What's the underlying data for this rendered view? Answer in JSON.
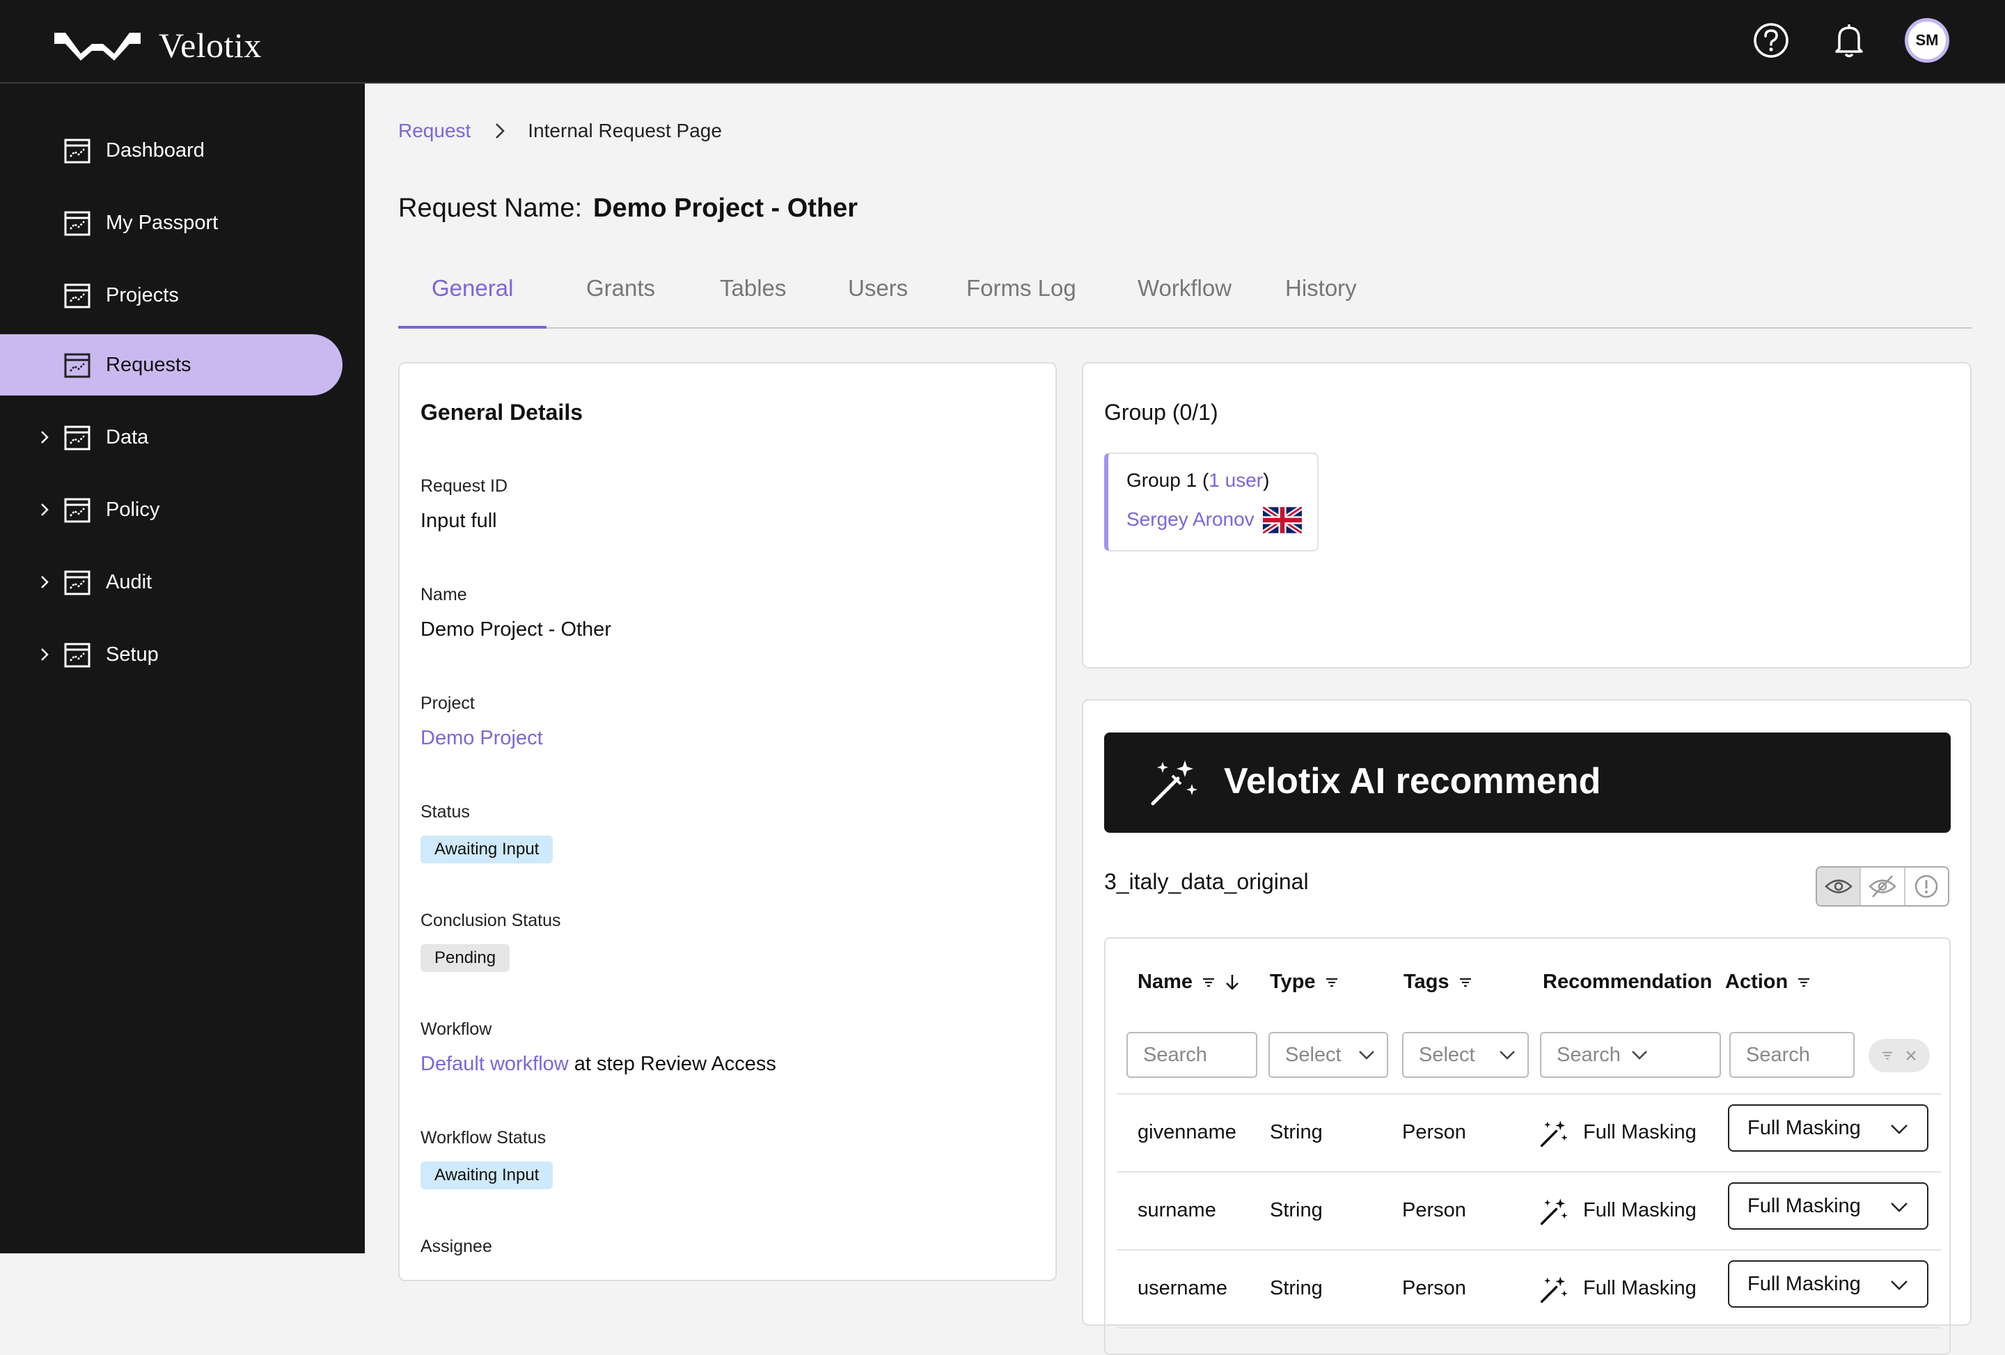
{
  "app": {
    "name": "Velotix",
    "avatar_initials": "SM",
    "accent": "#7c66d9"
  },
  "sidebar": {
    "items": [
      {
        "label": "Dashboard",
        "expandable": false,
        "active": false
      },
      {
        "label": "My Passport",
        "expandable": false,
        "active": false
      },
      {
        "label": "Projects",
        "expandable": false,
        "active": false
      },
      {
        "label": "Requests",
        "expandable": false,
        "active": true
      },
      {
        "label": "Data",
        "expandable": true,
        "active": false
      },
      {
        "label": "Policy",
        "expandable": true,
        "active": false
      },
      {
        "label": "Audit",
        "expandable": true,
        "active": false
      },
      {
        "label": "Setup",
        "expandable": true,
        "active": false
      }
    ]
  },
  "breadcrumb": {
    "root": "Request",
    "current": "Internal Request Page"
  },
  "request": {
    "name_label": "Request Name:",
    "name": "Demo Project - Other"
  },
  "tabs": [
    {
      "label": "General",
      "active": true
    },
    {
      "label": "Grants",
      "active": false
    },
    {
      "label": "Tables",
      "active": false
    },
    {
      "label": "Users",
      "active": false
    },
    {
      "label": "Forms Log",
      "active": false
    },
    {
      "label": "Workflow",
      "active": false
    },
    {
      "label": "History",
      "active": false
    }
  ],
  "general": {
    "title": "General Details",
    "request_id_label": "Request ID",
    "request_id": "Input full",
    "name_label": "Name",
    "name": "Demo Project - Other",
    "project_label": "Project",
    "project": "Demo Project",
    "status_label": "Status",
    "status": "Awaiting Input",
    "conclusion_label": "Conclusion Status",
    "conclusion": "Pending",
    "workflow_label": "Workflow",
    "workflow_link": "Default workflow",
    "workflow_suffix": " at step Review Access",
    "workflow_status_label": "Workflow Status",
    "workflow_status": "Awaiting Input",
    "assignee_label": "Assignee"
  },
  "group": {
    "title": "Group (0/1)",
    "group_name": "Group 1 (",
    "group_users": "1 user",
    "group_close": ")",
    "member": "Sergey Aronov"
  },
  "ai": {
    "banner": "Velotix AI recommend",
    "dataset": "3_italy_data_original",
    "columns": {
      "name": "Name",
      "type": "Type",
      "tags": "Tags",
      "recommendation": "Recommendation",
      "action": "Action"
    },
    "filters": {
      "name": "Search",
      "type": "Select",
      "tags": "Select",
      "recommendation": "Search",
      "action": "Search"
    },
    "rows": [
      {
        "name": "givenname",
        "type": "String",
        "tags": "Person",
        "recommendation": "Full Masking",
        "action": "Full Masking"
      },
      {
        "name": "surname",
        "type": "String",
        "tags": "Person",
        "recommendation": "Full Masking",
        "action": "Full Masking"
      },
      {
        "name": "username",
        "type": "String",
        "tags": "Person",
        "recommendation": "Full Masking",
        "action": "Full Masking"
      }
    ]
  }
}
